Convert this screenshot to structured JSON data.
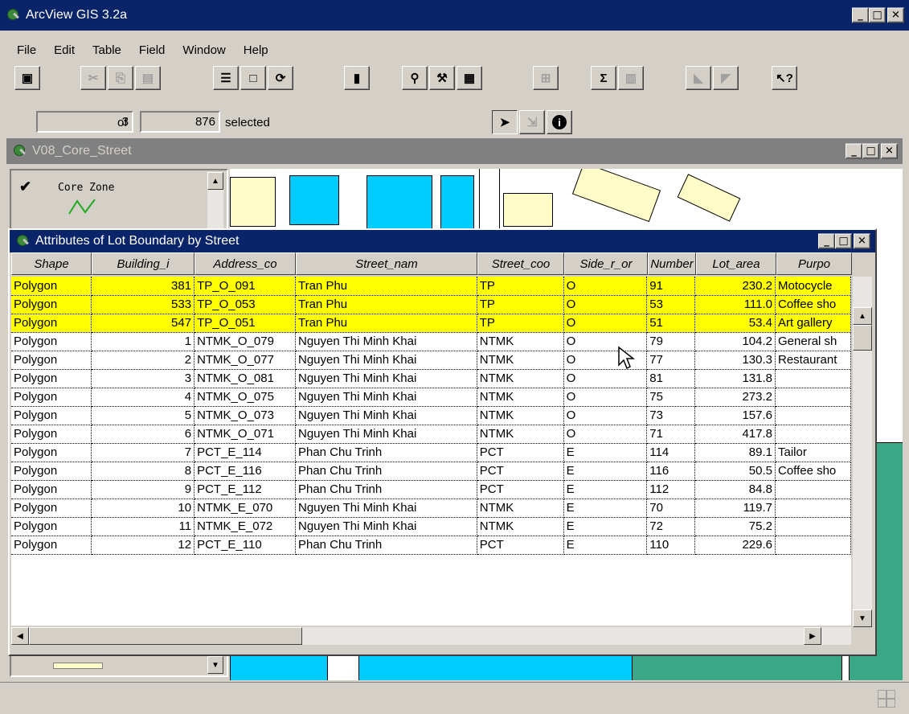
{
  "app": {
    "title": "ArcView GIS 3.2a",
    "menu": [
      "File",
      "Edit",
      "Table",
      "Field",
      "Window",
      "Help"
    ]
  },
  "toolbar": {
    "buttons": [
      {
        "name": "save-button",
        "glyph": "▣"
      },
      {
        "name": "cut-button",
        "glyph": "✂"
      },
      {
        "name": "copy-button",
        "glyph": "⎘"
      },
      {
        "name": "paste-button",
        "glyph": "▤"
      },
      {
        "name": "table-properties-button",
        "glyph": "☰"
      },
      {
        "name": "refresh-button",
        "glyph": "⟳"
      },
      {
        "name": "chart-button",
        "glyph": "▮"
      },
      {
        "name": "find-button",
        "glyph": "⚲"
      },
      {
        "name": "query-button",
        "glyph": "⚒"
      },
      {
        "name": "promote-button",
        "glyph": "▦"
      },
      {
        "name": "summarize-button",
        "glyph": "Σ"
      },
      {
        "name": "help-button",
        "glyph": "?"
      }
    ]
  },
  "selection": {
    "selected_count": "3",
    "of_label": "of",
    "total_count": "876",
    "selected_label": "selected"
  },
  "tools": [
    "select-pointer",
    "select-records",
    "identify"
  ],
  "view_window": {
    "title": "V08_Core_Street",
    "legend_label": "Core Zone"
  },
  "table_window": {
    "title": "Attributes of Lot Boundary by Street",
    "columns": [
      "Shape",
      "Building_i",
      "Address_co",
      "Street_nam",
      "Street_coo",
      "Side_r_or",
      "Number",
      "Lot_area",
      "Purpo"
    ],
    "rows": [
      {
        "selected": true,
        "cells": [
          "Polygon",
          "381",
          "TP_O_091",
          "Tran Phu",
          "TP",
          "O",
          "91",
          "230.2",
          "Motocycle"
        ]
      },
      {
        "selected": true,
        "cells": [
          "Polygon",
          "533",
          "TP_O_053",
          "Tran Phu",
          "TP",
          "O",
          "53",
          "111.0",
          "Coffee sho"
        ]
      },
      {
        "selected": true,
        "cells": [
          "Polygon",
          "547",
          "TP_O_051",
          "Tran Phu",
          "TP",
          "O",
          "51",
          "53.4",
          "Art gallery"
        ]
      },
      {
        "selected": false,
        "cells": [
          "Polygon",
          "1",
          "NTMK_O_079",
          "Nguyen Thi Minh Khai",
          "NTMK",
          "O",
          "79",
          "104.2",
          "General sh"
        ]
      },
      {
        "selected": false,
        "cells": [
          "Polygon",
          "2",
          "NTMK_O_077",
          "Nguyen Thi Minh Khai",
          "NTMK",
          "O",
          "77",
          "130.3",
          "Restaurant"
        ]
      },
      {
        "selected": false,
        "cells": [
          "Polygon",
          "3",
          "NTMK_O_081",
          "Nguyen Thi Minh Khai",
          "NTMK",
          "O",
          "81",
          "131.8",
          ""
        ]
      },
      {
        "selected": false,
        "cells": [
          "Polygon",
          "4",
          "NTMK_O_075",
          "Nguyen Thi Minh Khai",
          "NTMK",
          "O",
          "75",
          "273.2",
          ""
        ]
      },
      {
        "selected": false,
        "cells": [
          "Polygon",
          "5",
          "NTMK_O_073",
          "Nguyen Thi Minh Khai",
          "NTMK",
          "O",
          "73",
          "157.6",
          ""
        ]
      },
      {
        "selected": false,
        "cells": [
          "Polygon",
          "6",
          "NTMK_O_071",
          "Nguyen Thi Minh Khai",
          "NTMK",
          "O",
          "71",
          "417.8",
          ""
        ]
      },
      {
        "selected": false,
        "cells": [
          "Polygon",
          "7",
          "PCT_E_114",
          "Phan Chu Trinh",
          "PCT",
          "E",
          "114",
          "89.1",
          "Tailor"
        ]
      },
      {
        "selected": false,
        "cells": [
          "Polygon",
          "8",
          "PCT_E_116",
          "Phan Chu Trinh",
          "PCT",
          "E",
          "116",
          "50.5",
          "Coffee sho"
        ]
      },
      {
        "selected": false,
        "cells": [
          "Polygon",
          "9",
          "PCT_E_112",
          "Phan Chu Trinh",
          "PCT",
          "E",
          "112",
          "84.8",
          ""
        ]
      },
      {
        "selected": false,
        "cells": [
          "Polygon",
          "10",
          "NTMK_E_070",
          "Nguyen Thi Minh Khai",
          "NTMK",
          "E",
          "70",
          "119.7",
          ""
        ]
      },
      {
        "selected": false,
        "cells": [
          "Polygon",
          "11",
          "NTMK_E_072",
          "Nguyen Thi Minh Khai",
          "NTMK",
          "E",
          "72",
          "75.2",
          ""
        ]
      },
      {
        "selected": false,
        "cells": [
          "Polygon",
          "12",
          "PCT_E_110",
          "Phan Chu Trinh",
          "PCT",
          "E",
          "110",
          "229.6",
          ""
        ]
      }
    ]
  },
  "colors": {
    "active_title": "#0a246a",
    "inactive_title": "#808080",
    "selection": "#ffff00",
    "map_cyan": "#00ccff",
    "map_lot": "#fffcc8",
    "map_teal": "#3aa886"
  }
}
